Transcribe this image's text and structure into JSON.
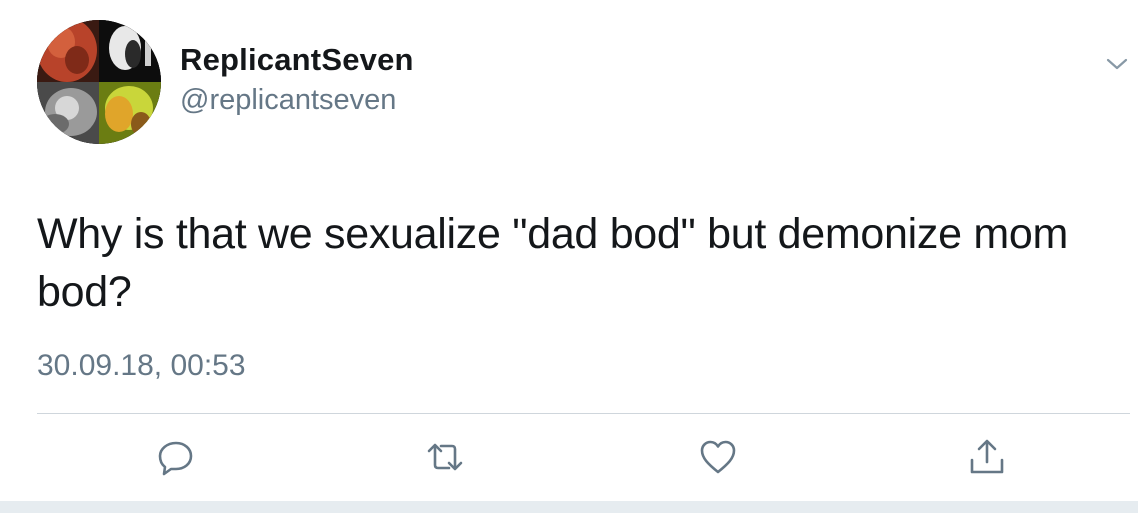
{
  "user": {
    "display_name": "ReplicantSeven",
    "handle": "@replicantseven"
  },
  "tweet": {
    "text": "Why is that we sexualize \"dad bod\" but demonize mom bod?",
    "timestamp": "30.09.18, 00:53"
  },
  "icons": {
    "more": "chevron-down-icon",
    "reply": "reply-icon",
    "retweet": "retweet-icon",
    "like": "heart-icon",
    "share": "share-icon"
  },
  "colors": {
    "text": "#14171a",
    "secondary": "#657786",
    "divider": "#cfd6dc"
  }
}
